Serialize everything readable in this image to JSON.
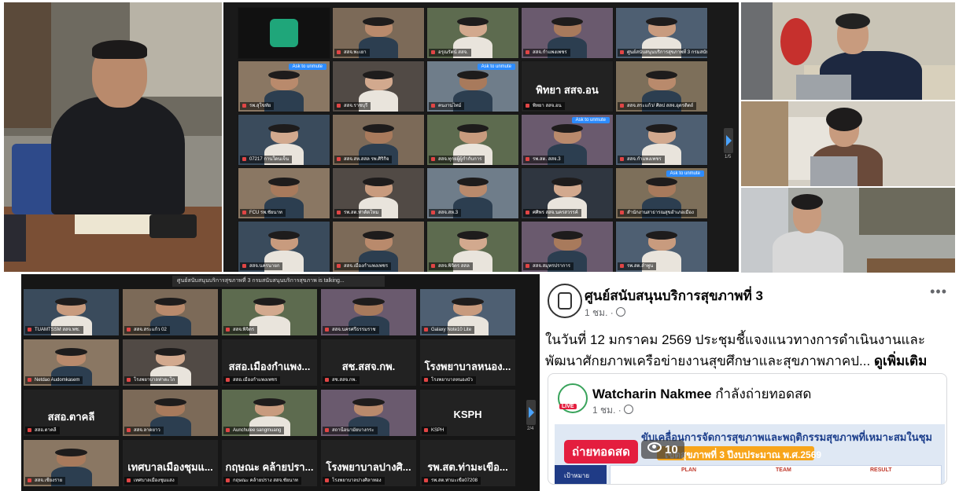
{
  "zoom_top": {
    "tiles": [
      {
        "name": "",
        "big": ""
      },
      {
        "name": "สสจ.พะเยา",
        "big": ""
      },
      {
        "name": "อรุณรัตน์ สสจ.",
        "big": ""
      },
      {
        "name": "สสจ.กำแพงเพชร",
        "big": ""
      },
      {
        "name": "ศูนย์สนับสนุนบริการสุขภาพที่ 3 กรมสนับสนุน",
        "big": ""
      },
      {
        "name": "รพ.สุโขทัย",
        "big": ""
      },
      {
        "name": "สสจ.ราชบุรี",
        "big": ""
      },
      {
        "name": "คนงานไทม์",
        "big": ""
      },
      {
        "name": "พิทยา สสจ.อน",
        "big": "พิทยา สสจ.อน"
      },
      {
        "name": "สสจ.สระแก้ว/ ศิลป สสจ.อุตรดิตถ์",
        "big": ""
      },
      {
        "name": "07217 กานใดนเจ็น",
        "big": ""
      },
      {
        "name": "สสจ.สห.สสล รพ.ศิริกิจ",
        "big": ""
      },
      {
        "name": "สสจ.ทุกยผู้ผู้กำกับการ",
        "big": ""
      },
      {
        "name": "รพ.สต. สสจ.3",
        "big": ""
      },
      {
        "name": "สสจ.กำแพงเพชร",
        "big": ""
      },
      {
        "name": "FCU รพ.ชัยนาท",
        "big": ""
      },
      {
        "name": "รพ.สต.ท่าดัดโหม",
        "big": ""
      },
      {
        "name": "สสจ.สห.3",
        "big": ""
      },
      {
        "name": "ศศิพร สสจ.นครสวรรค์",
        "big": ""
      },
      {
        "name": "สำนักงานสาธารณสุขอำเภอเมือง",
        "big": ""
      },
      {
        "name": "สสจ.นครนายก",
        "big": ""
      },
      {
        "name": "สสจ.เมืองกำแพงเพชร",
        "big": ""
      },
      {
        "name": "สสจ.พิจิตร สสล",
        "big": ""
      },
      {
        "name": "สสจ.สมุทรปราการ",
        "big": ""
      },
      {
        "name": "รพ.สต.ลำพูน",
        "big": ""
      }
    ],
    "ask_label": "Ask to unmute",
    "page_label": "1/5"
  },
  "zoom_bottom": {
    "speaking": "ศูนย์สนับสนุนบริการสุขภาพที่ 3 กรมสนับสนุนบริการสุขภาพ is talking...",
    "tiles": [
      {
        "name": "TUAMTSSM สสจ.พช.",
        "big": ""
      },
      {
        "name": "สสจ.สระแก้ว 02",
        "big": ""
      },
      {
        "name": "สสจ.พิจิตร",
        "big": ""
      },
      {
        "name": "สสจ.นครศรีธรรมราช",
        "big": ""
      },
      {
        "name": "Galaxy Note10 Lite",
        "big": ""
      },
      {
        "name": "Netdao Audomkasem",
        "big": ""
      },
      {
        "name": "โรงพยาบาลท่าตะโก",
        "big": ""
      },
      {
        "name": "สสอ.เมืองกำแพงเพชร",
        "big": "สสอ.เมืองกำแพง..."
      },
      {
        "name": "สช.สสจ.กพ.",
        "big": "สช.สสจ.กพ."
      },
      {
        "name": "โรงพยาบาลหนองบัว",
        "big": "โรงพยาบาลหนอง..."
      },
      {
        "name": "สสอ.ตาคลี",
        "big": "สสอ.ตาคลี"
      },
      {
        "name": "สสจ.ลาดยาว",
        "big": ""
      },
      {
        "name": "Aunchulee sangmuang",
        "big": ""
      },
      {
        "name": "สถานีอนามัยบางกระ",
        "big": ""
      },
      {
        "name": "KSPH",
        "big": "KSPH"
      },
      {
        "name": "สสจ.เชียงราย",
        "big": ""
      },
      {
        "name": "เทศบาลเมืองชุมแสง",
        "big": "เทศบาลเมืองชุมแ..."
      },
      {
        "name": "กฤษณะ คล้ายปราง สสจ.ชัยนาท",
        "big": "กฤษณะ คล้ายปรา..."
      },
      {
        "name": "โรงพยาบาลปางศิลาทอง",
        "big": "โรงพยาบาลปางศิ..."
      },
      {
        "name": "รพ.สต.ท่ามะเขือ07208",
        "big": "รพ.สต.ท่ามะเขือ..."
      }
    ],
    "page_label": "2/4"
  },
  "facebook": {
    "page_name": "ศูนย์สนับสนุนบริการสุขภาพที่ 3",
    "time": "1 ชม. · ",
    "globe_icon": "globe-icon",
    "more_icon": "more-options-icon",
    "post_text": "ในวันที่ 12 มกราคม 2569 ประชุมชี้แจงแนวทางการดำเนินงานและพัฒนาศักยภาพเครือข่ายงานสุขศึกษาและสุขภาพภาคป...",
    "see_more": "ดูเพิ่มเติม",
    "shared": {
      "user": "Watcharin Nakmee",
      "action": "กำลังถ่ายทอดสด",
      "time": "1 ชม. · ",
      "live_badge": "LIVE",
      "live_label": "ถ่ายทอดสด",
      "viewers": "10",
      "banner_title": "ขับเคลื่อนการจัดการสุขภาพและพฤติกรรมสุขภาพที่เหมาะสมในชุม",
      "banner_sub": "เขตสุขภาพที่ 3 ปีงบประมาณ พ.ศ.2569",
      "goal_label": "เป้าหมาย",
      "plan": "PLAN",
      "team": "TEAM",
      "result": "RESULT"
    }
  }
}
